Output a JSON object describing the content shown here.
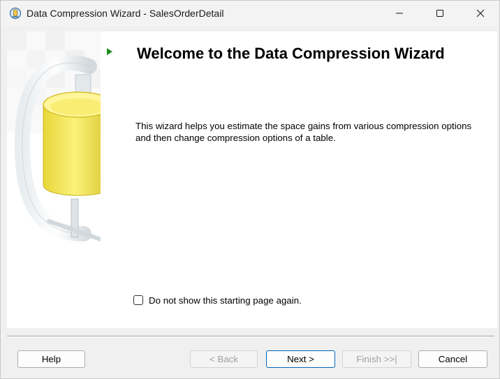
{
  "window": {
    "title": "Data Compression Wizard - SalesOrderDetail",
    "icon": "sql-server-management-icon"
  },
  "window_controls": [
    "minimize-icon",
    "maximize-icon",
    "close-icon"
  ],
  "side_graphic": "clamp-with-yellow-cylinder",
  "page": {
    "heading": "Welcome to the Data Compression Wizard",
    "description": "This wizard helps you estimate the space gains from various compression options and then change compression options of a table.",
    "dont_show_label": "Do not show this starting page again.",
    "dont_show_checked": false
  },
  "buttons": {
    "help": "Help",
    "back": "< Back",
    "next": "Next >",
    "finish": "Finish >>|",
    "cancel": "Cancel"
  },
  "colors": {
    "accent": "#0067c0",
    "arrow": "#1f8a1f",
    "cylinder": "#f2e44a"
  }
}
